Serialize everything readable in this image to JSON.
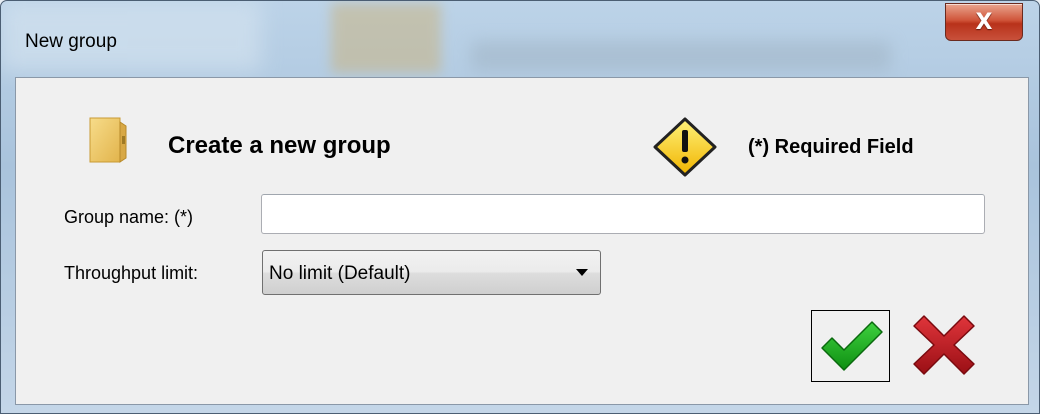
{
  "window": {
    "title": "New group",
    "close_glyph": "X"
  },
  "header": {
    "title": "Create a new group",
    "icon": "folder-icon",
    "required_icon": "warning-icon",
    "required_note": "(*) Required Field"
  },
  "form": {
    "group_name": {
      "label": "Group name: (*)",
      "value": "",
      "placeholder": ""
    },
    "throughput_limit": {
      "label": "Throughput limit:",
      "selected": "No limit (Default)"
    }
  },
  "actions": {
    "ok_icon": "checkmark-icon",
    "cancel_icon": "cross-icon"
  },
  "colors": {
    "ok_green": "#1aa51a",
    "cancel_red": "#c0181f",
    "warning_yellow": "#f5c518",
    "folder_yellow": "#f0cc6a"
  }
}
